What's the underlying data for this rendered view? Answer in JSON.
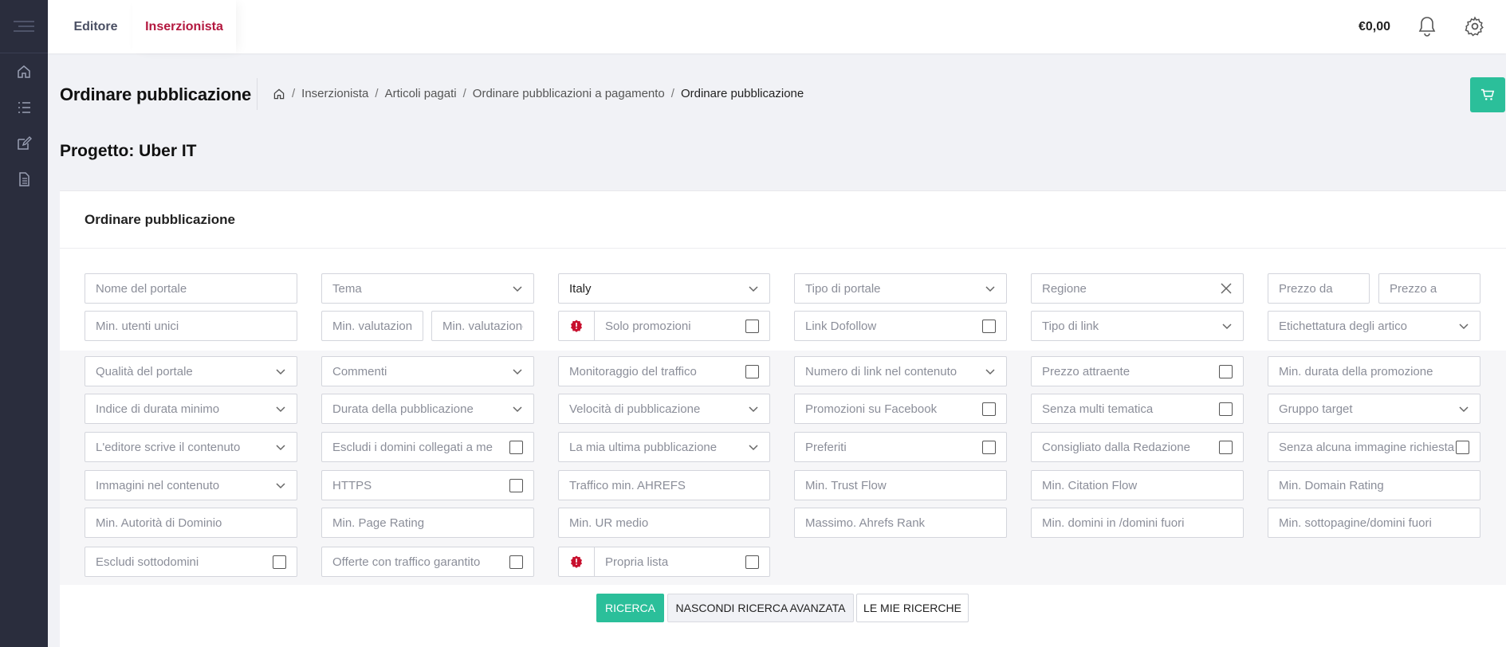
{
  "topbar": {
    "tabs": [
      {
        "label": "Editore"
      },
      {
        "label": "Inserzionista"
      }
    ],
    "balance": "€0,00"
  },
  "page": {
    "title": "Ordinare pubblicazione",
    "breadcrumb": [
      "Inserzionista",
      "Articoli pagati",
      "Ordinare pubblicazioni a pagamento",
      "Ordinare pubblicazione"
    ],
    "project": "Progetto: Uber IT"
  },
  "card": {
    "title": "Ordinare pubblicazione"
  },
  "filters": {
    "r1": {
      "portal_name": "Nome del portale",
      "theme": "Tema",
      "country": "Italy",
      "portal_type": "Tipo di portale",
      "region": "Regione",
      "price_from": "Prezzo da",
      "price_to": "Prezzo a"
    },
    "r2": {
      "min_unique_users": "Min. utenti unici",
      "min_rating_1": "Min. valutazione",
      "min_rating_2": "Min. valutazione",
      "only_promotions": "Solo promozioni",
      "link_dofollow": "Link Dofollow",
      "link_type": "Tipo di link",
      "article_label": "Etichettatura degli artico"
    },
    "r3": {
      "portal_quality": "Qualità del portale",
      "comments": "Commenti",
      "traffic_monitoring": "Monitoraggio del traffico",
      "links_in_content": "Numero di link nel contenuto",
      "attractive_price": "Prezzo attraente",
      "min_promo_duration": "Min. durata della promozione"
    },
    "r4": {
      "min_duration_index": "Indice di durata minimo",
      "publication_duration": "Durata della pubblicazione",
      "publication_speed": "Velocità di pubblicazione",
      "facebook_promotions": "Promozioni su Facebook",
      "no_multi_theme": "Senza multi tematica",
      "target_group": "Gruppo target"
    },
    "r5": {
      "editor_writes": "L'editore scrive il contenuto",
      "exclude_linked_domains": "Escludi i domini collegati a me",
      "my_last_publication": "La mia ultima pubblicazione",
      "favorites": "Preferiti",
      "recommended": "Consigliato dalla Redazione",
      "no_image_required": "Senza alcuna immagine richiesta"
    },
    "r6": {
      "images_in_content": "Immagini nel contenuto",
      "https": "HTTPS",
      "min_ahrefs_traffic": "Traffico min. AHREFS",
      "min_trust_flow": "Min. Trust Flow",
      "min_citation_flow": "Min. Citation Flow",
      "min_domain_rating": "Min. Domain Rating"
    },
    "r7": {
      "min_domain_authority": "Min. Autorità di Dominio",
      "min_page_rating": "Min. Page Rating",
      "min_ur": "Min. UR medio",
      "max_ahrefs_rank": "Massimo. Ahrefs Rank",
      "min_domains_in_out": "Min. domini in /domini fuori",
      "min_subpages_domains": "Min. sottopagine/domini fuori"
    },
    "r8": {
      "exclude_subdomains": "Escludi sottodomini",
      "guaranteed_traffic": "Offerte con traffico garantito",
      "own_list": "Propria lista"
    }
  },
  "buttons": {
    "search": "RICERCA",
    "hide_advanced": "NASCONDI RICERCA AVANZATA",
    "my_searches": "LE MIE RICERCHE"
  },
  "colors": {
    "accent_green": "#2bbf9a",
    "active_tab": "#b3183f",
    "sidebar": "#2a2d3d",
    "alert_red": "#c8102e"
  }
}
